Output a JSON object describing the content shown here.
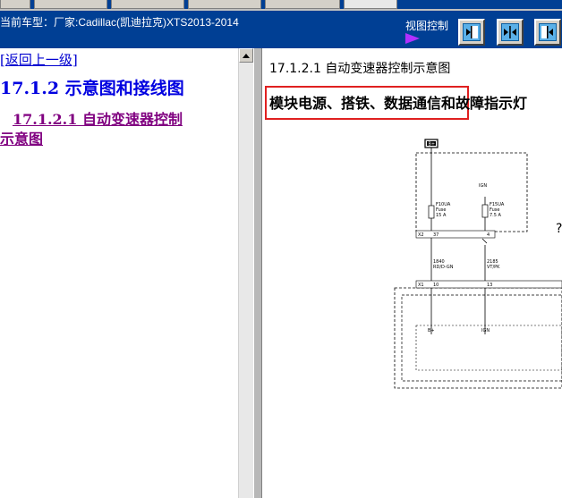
{
  "header": {
    "car_model": "当前车型：厂家:Cadillac(凯迪拉克)XTS2013-2014",
    "view_control_label": "视图控制"
  },
  "sidebar": {
    "back_link": "[返回上一级]",
    "section_title": "17.1.2 示意图和接线图",
    "item_link_line1": "17.1.2.1 自动变速器控制",
    "item_link_line2": "示意图"
  },
  "content": {
    "title": "17.1.2.1 自动变速器控制示意图",
    "highlighted_heading": "模块电源、搭铁、数据通信和故障指示灯"
  },
  "diagram": {
    "battery_label": "B+",
    "fuse1_label": "F10UA",
    "fuse1_type": "Fuse",
    "fuse1_rating": "15 A",
    "fuse2_top1": "IGN",
    "fuse2_label": "F15UA",
    "fuse2_type": "Fuse",
    "fuse2_rating": "7.5 A",
    "conn_x2": "X2",
    "pin_37": "37",
    "pin_4": "4",
    "wire1_num": "1840",
    "wire1_color": "RD/D-GN",
    "wire2_num": "2185",
    "wire2_color": "VT/PK",
    "conn_x1": "X1",
    "pin_10": "10",
    "pin_13": "13",
    "term_bplus": "B+",
    "term_ign": "IGN",
    "ign_marker": "?"
  },
  "colors": {
    "header_bg": "#003f94",
    "highlight_border": "#e02020",
    "sidebar_title": "#0000e0",
    "visited_link": "#800080"
  }
}
